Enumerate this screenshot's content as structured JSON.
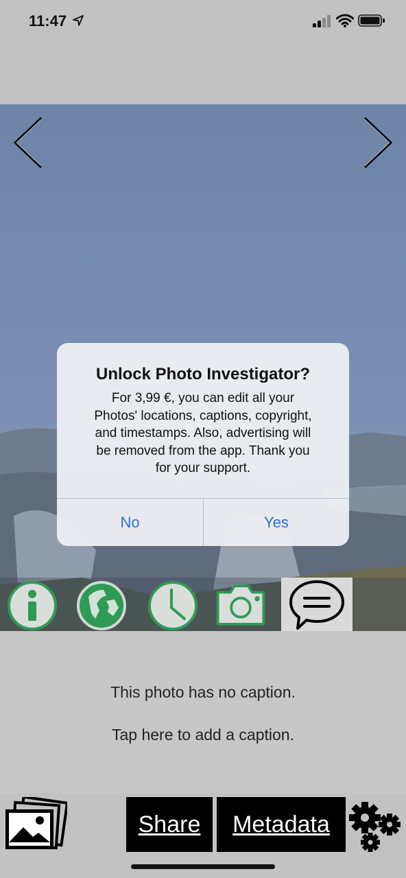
{
  "status_bar": {
    "time": "11:47",
    "icons": [
      "location-arrow-icon",
      "cellular-signal-icon",
      "wifi-icon",
      "battery-icon"
    ]
  },
  "photo": {
    "prev_icon": "chevron-left-icon",
    "next_icon": "chevron-right-icon"
  },
  "toolbar": {
    "icons": [
      "info-icon",
      "globe-icon",
      "clock-icon",
      "camera-icon",
      "speech-bubble-icon"
    ],
    "accent_color": "#2f9a55",
    "selected": "speech-bubble-icon"
  },
  "caption": {
    "no_caption": "This photo has no caption.",
    "tap_hint": "Tap here to add a caption."
  },
  "bottom_bar": {
    "photos_icon": "photo-library-icon",
    "share_label": "Share",
    "metadata_label": "Metadata",
    "settings_icon": "gears-icon"
  },
  "alert": {
    "title": "Unlock Photo Investigator?",
    "message_lines": [
      "For 3,99 €, you can edit all your",
      "Photos' locations, captions, copyright,",
      "and timestamps.  Also, advertising will",
      "be removed from the app.  Thank you",
      "for your support."
    ],
    "no_label": "No",
    "yes_label": "Yes",
    "button_color": "#2a6fd6"
  }
}
